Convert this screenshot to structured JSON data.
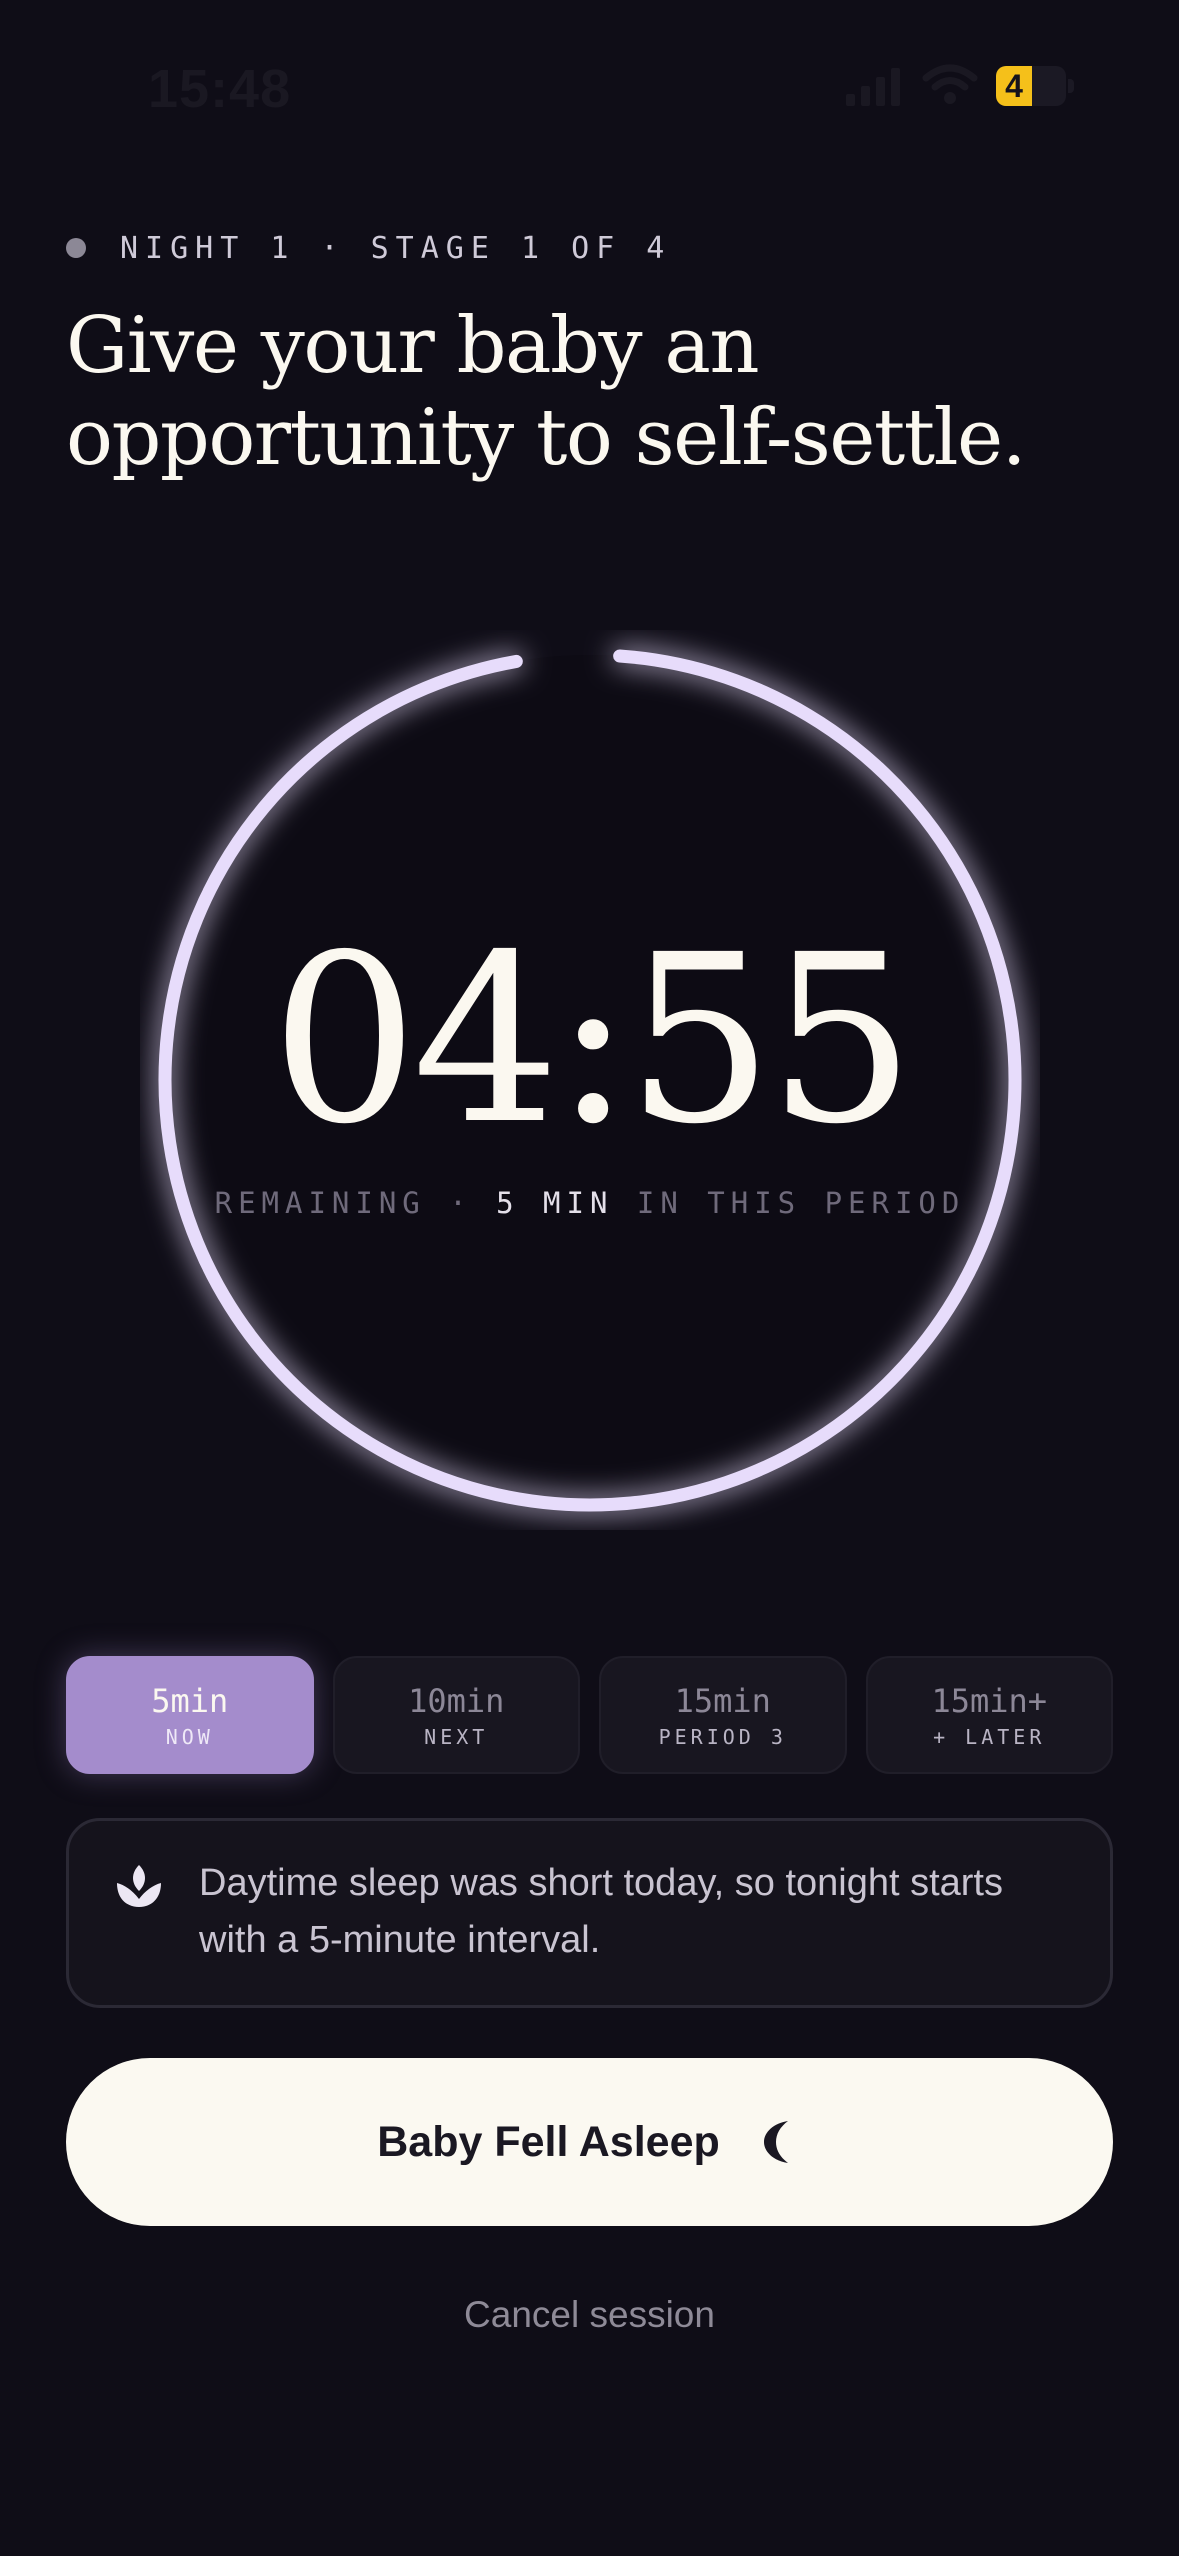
{
  "status_bar": {
    "time": "15:48",
    "battery_level": "4"
  },
  "header": {
    "stage_label": "NIGHT 1 · STAGE 1 OF 4",
    "headline_line1": "Give your baby an",
    "headline_line2": "opportunity to self-settle."
  },
  "timer": {
    "value": "04:55",
    "caption_prefix": "REMAINING · ",
    "caption_highlight": "5 MIN",
    "caption_suffix": " IN THIS PERIOD",
    "progress_fraction": 0.983
  },
  "intervals": [
    {
      "value": "5min",
      "label": "NOW",
      "active": true
    },
    {
      "value": "10min",
      "label": "NEXT",
      "active": false
    },
    {
      "value": "15min",
      "label": "PERIOD 3",
      "active": false
    },
    {
      "value": "15min+",
      "label": "+ LATER",
      "active": false
    }
  ],
  "info_card": {
    "icon": "lotus-icon",
    "text": "Daytime sleep was short today, so tonight starts with a 5-minute interval."
  },
  "primary_action": {
    "label": "Baby Fell Asleep",
    "icon": "moon-icon"
  },
  "secondary_action": {
    "label": "Cancel session"
  },
  "colors": {
    "background": "#0f0d17",
    "ring": "#e7dcfb",
    "accent": "#a48ccc",
    "button": "#fbf9f1"
  }
}
